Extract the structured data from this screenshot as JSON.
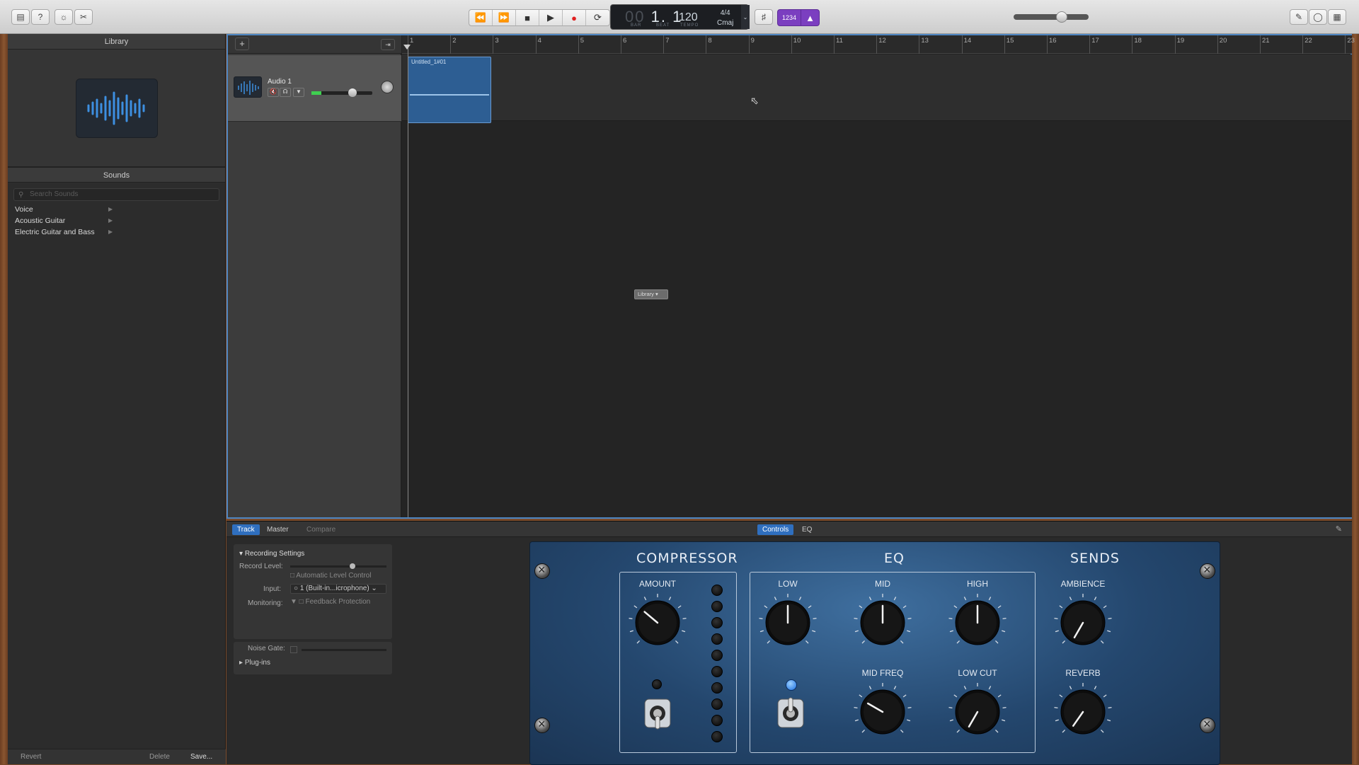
{
  "toolbar": {
    "icons": [
      "library-icon",
      "help-icon",
      "smart-controls-icon",
      "scissors-icon"
    ],
    "transport": [
      "rewind",
      "fast-forward",
      "stop",
      "play",
      "record",
      "cycle"
    ],
    "lcd": {
      "bar": "1",
      "beat": "1",
      "bar_label": "BAR",
      "beat_label": "BEAT",
      "tempo": "120",
      "tempo_label": "TEMPO",
      "time_signature": "4/4",
      "key": "Cmaj"
    },
    "count_in": "1234",
    "master_volume": 0.68
  },
  "library": {
    "title": "Library",
    "sounds_title": "Sounds",
    "search_placeholder": "Search Sounds",
    "categories": [
      "Voice",
      "Acoustic Guitar",
      "Electric Guitar and Bass"
    ],
    "footer": {
      "revert": "Revert",
      "delete": "Delete",
      "save": "Save..."
    }
  },
  "tracks": {
    "add_label": "+",
    "track_name": "Audio 1",
    "region_name": "Untitled_1#01",
    "ruler": [
      "1",
      "2",
      "3",
      "4",
      "5",
      "6",
      "7",
      "8",
      "9",
      "10",
      "11",
      "12",
      "13",
      "14",
      "15",
      "16",
      "17",
      "18",
      "19",
      "20",
      "21",
      "22",
      "23"
    ],
    "library_tooltip": "Library"
  },
  "smart_controls": {
    "tabs": {
      "track": "Track",
      "master": "Master",
      "compare": "Compare",
      "controls": "Controls",
      "eq": "EQ"
    },
    "recording": {
      "title": "Recording Settings",
      "record_level": "Record Level:",
      "auto_level": "Automatic Level Control",
      "input_label": "Input:",
      "input_value": "1 (Built-in...icrophone)",
      "monitoring_label": "Monitoring:",
      "feedback": "Feedback Protection",
      "noise_gate": "Noise Gate:",
      "plugins": "Plug-ins"
    },
    "amp": {
      "compressor": "COMPRESSOR",
      "eq": "EQ",
      "sends": "SENDS",
      "knobs": {
        "amount": "AMOUNT",
        "low": "LOW",
        "mid": "MID",
        "high": "HIGH",
        "ambience": "AMBIENCE",
        "mid_freq": "MID FREQ",
        "low_cut": "LOW CUT",
        "reverb": "REVERB"
      }
    }
  },
  "colors": {
    "accent": "#2f6fbf",
    "region": "#2d5e93",
    "amp_blue": "#24476e",
    "count_in": "#7b3fc0"
  }
}
